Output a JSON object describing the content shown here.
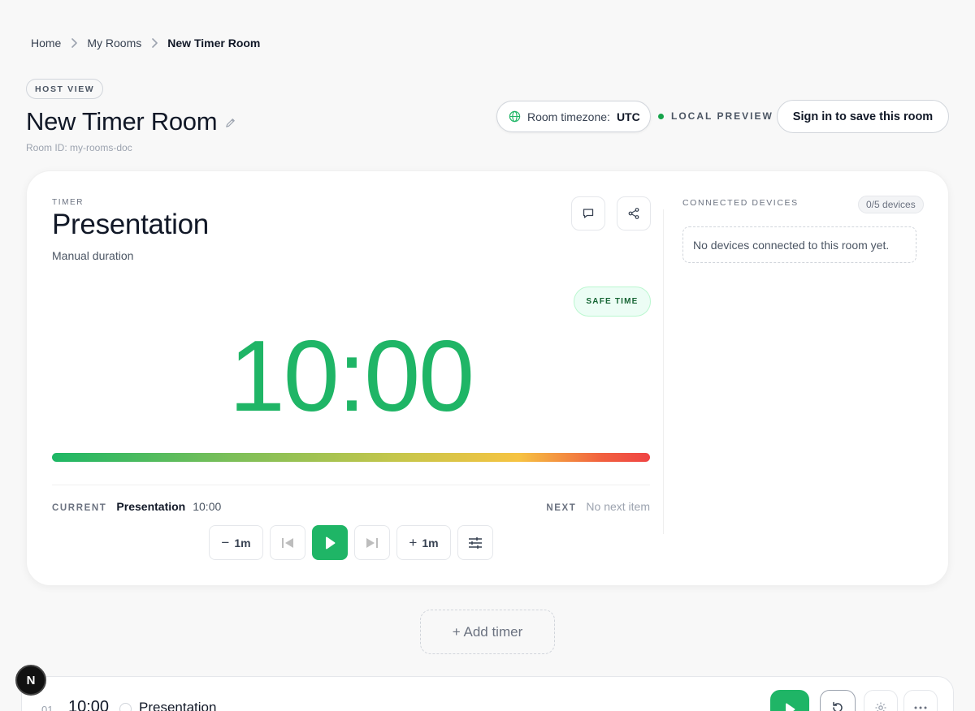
{
  "breadcrumb": {
    "items": [
      "Home",
      "My Rooms",
      "New Timer Room"
    ]
  },
  "header": {
    "badge": "HOST VIEW",
    "title": "New Timer Room",
    "room_id": "Room ID: my-rooms-doc",
    "timezone_label": "Room timezone:",
    "timezone_value": "UTC",
    "preview_label": "LOCAL PREVIEW",
    "signin_label": "Sign in to save this room"
  },
  "timer": {
    "label": "TIMER",
    "title": "Presentation",
    "subtitle": "Manual duration",
    "status_badge": "SAFE TIME",
    "display": "10:00",
    "progress_remaining": 1.0,
    "current_label": "CURRENT",
    "current_name": "Presentation",
    "current_time": "10:00",
    "next_label": "NEXT",
    "next_value": "No next item",
    "controls": {
      "minus_label": "1m",
      "plus_label": "1m"
    }
  },
  "devices": {
    "label": "CONNECTED DEVICES",
    "count": "0/5 devices",
    "empty_message": "No devices connected to this room yet."
  },
  "add_timer_label": "+ Add timer",
  "timer_list": [
    {
      "index": "01",
      "time": "10:00",
      "name": "Presentation"
    }
  ],
  "dev_badge": "N",
  "colors": {
    "accent_green": "#1fb566",
    "progress_gradient": [
      "#1db765",
      "#c6c64b",
      "#f6c342",
      "#ef4444"
    ]
  },
  "icons": [
    "chevron-right-icon",
    "pencil-icon",
    "globe-icon",
    "chat-icon",
    "share-icon",
    "skip-back-icon",
    "play-icon",
    "skip-forward-icon",
    "sliders-icon",
    "reset-icon",
    "gear-icon",
    "more-icon"
  ]
}
